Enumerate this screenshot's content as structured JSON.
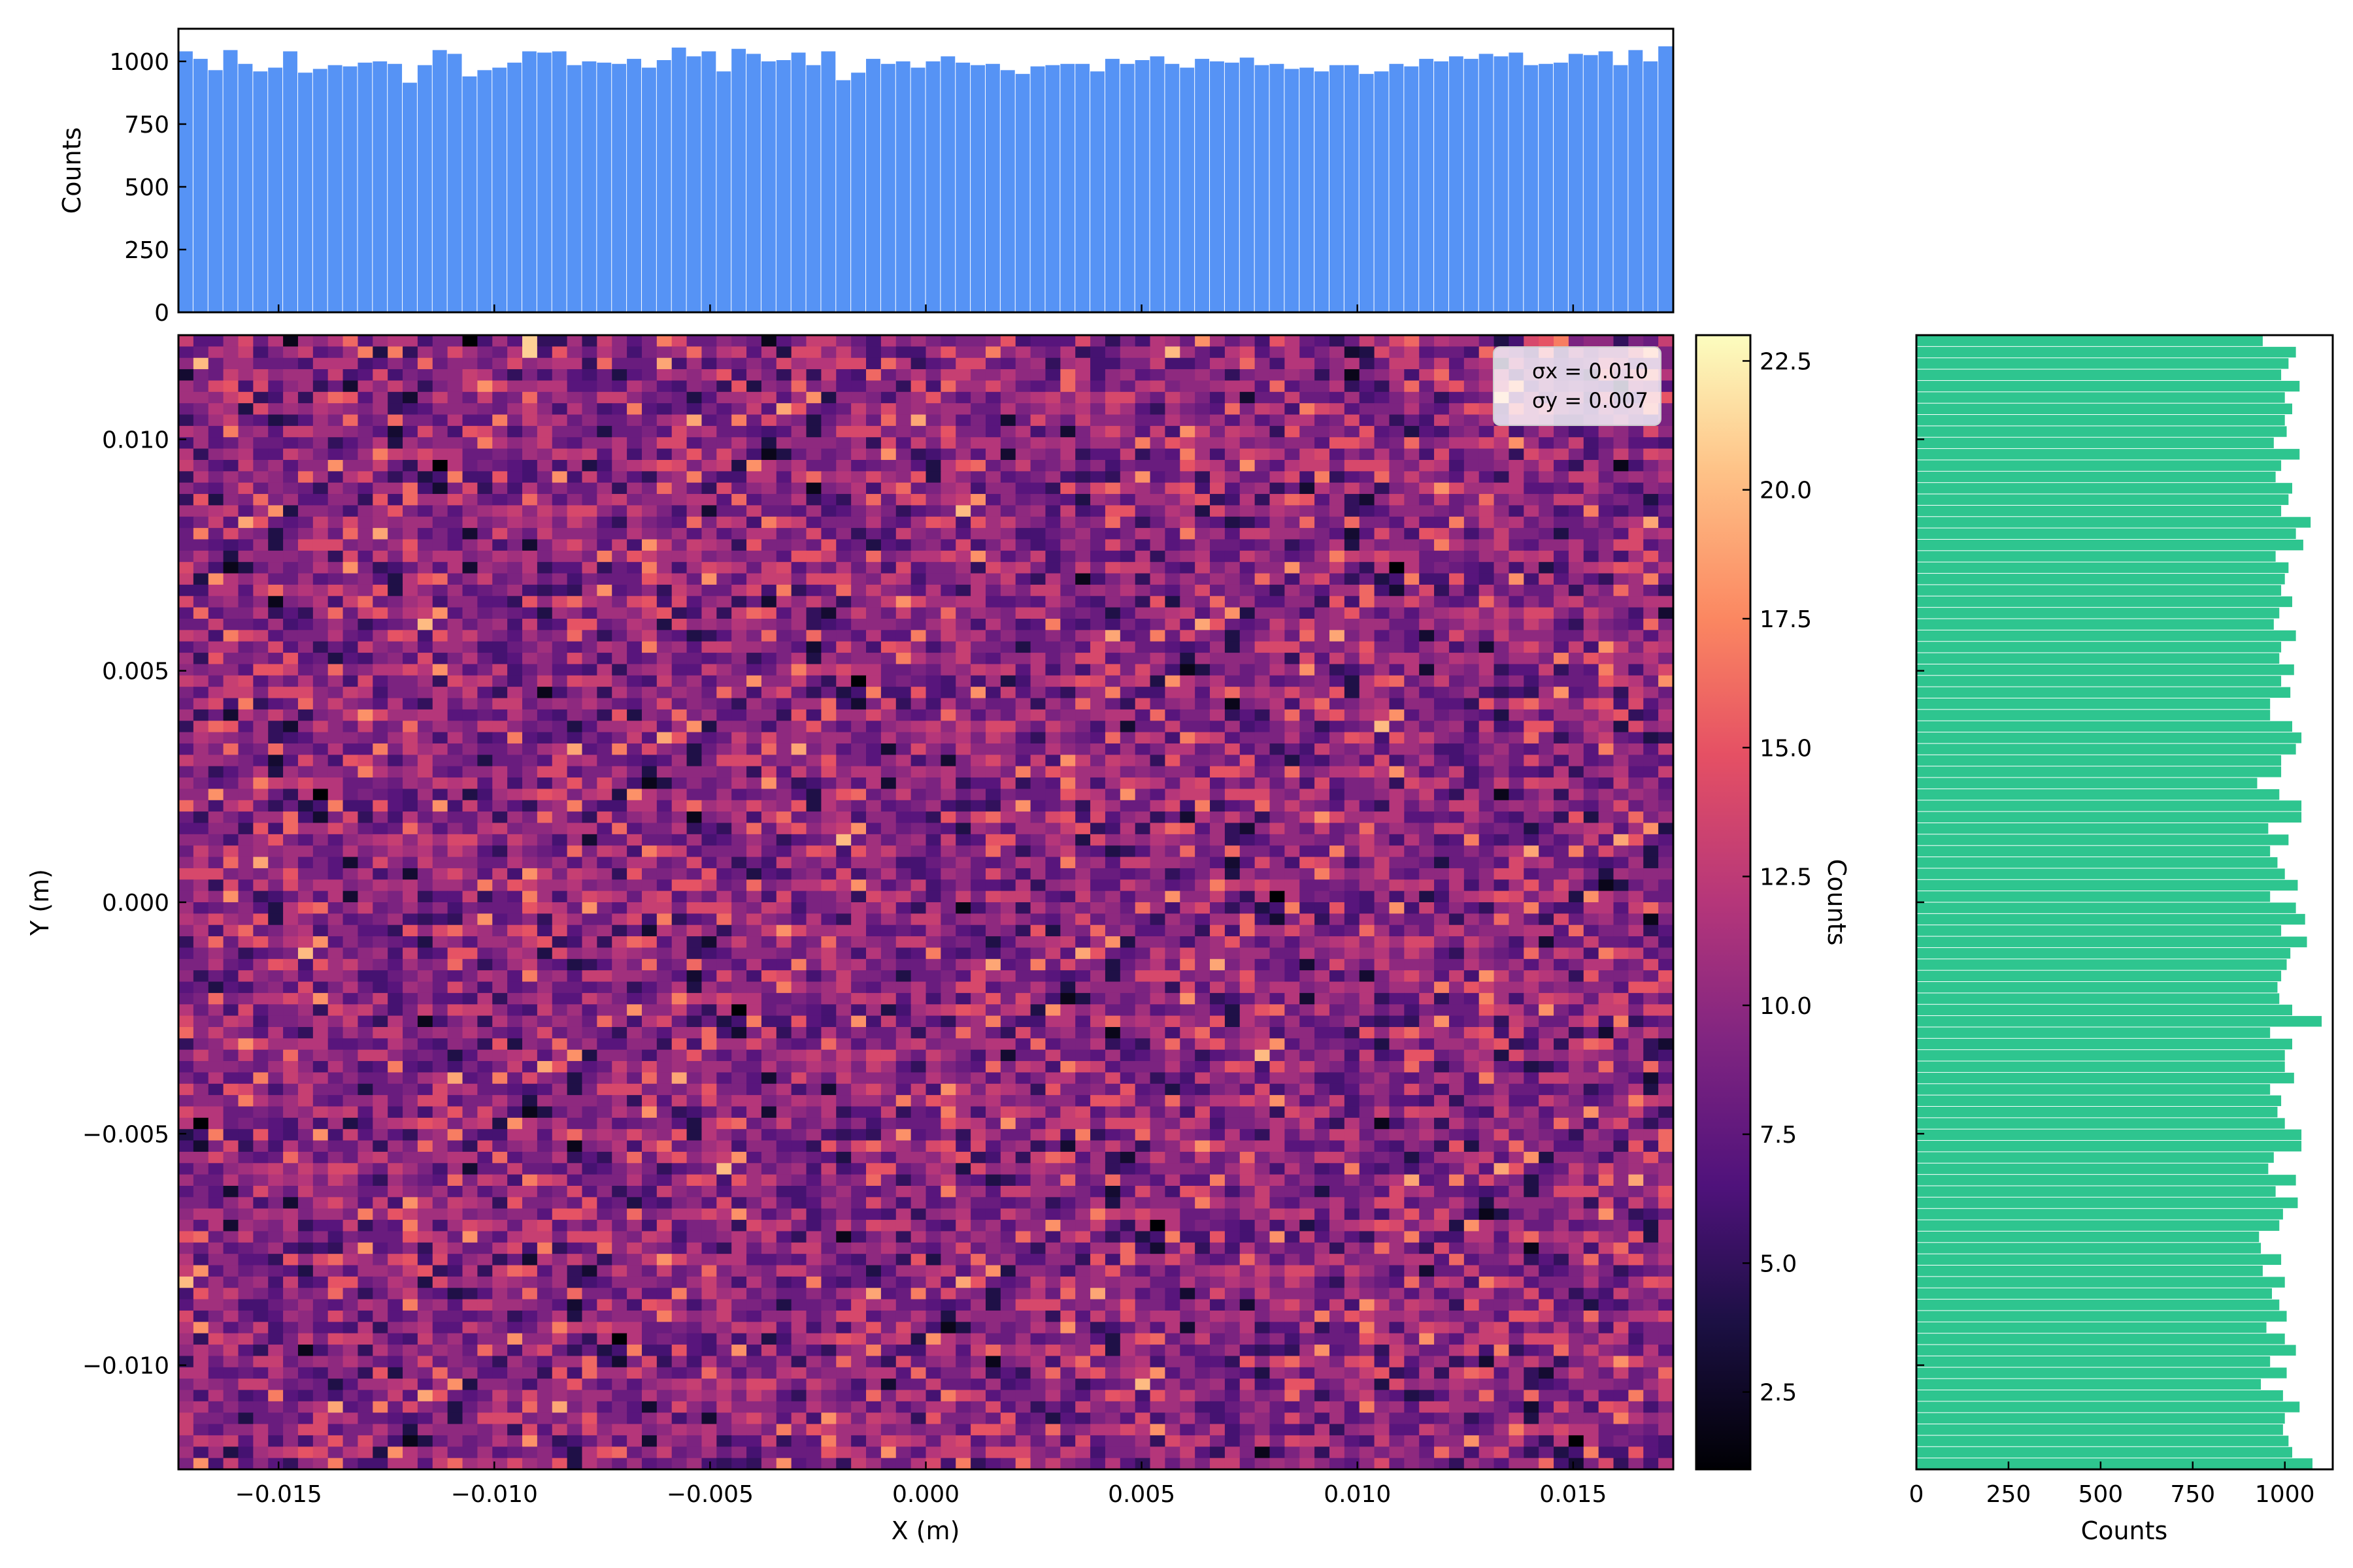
{
  "chart_data": [
    {
      "type": "heatmap",
      "xlabel": "X (m)",
      "ylabel": "Y (m)",
      "xlim": [
        -0.01732,
        0.01732
      ],
      "ylim": [
        -0.01225,
        0.01225
      ],
      "xticks": [
        -0.015,
        -0.01,
        -0.005,
        0.0,
        0.005,
        0.01,
        0.015
      ],
      "xtick_labels": [
        "−0.015",
        "−0.010",
        "−0.005",
        "0.000",
        "0.005",
        "0.010",
        "0.015"
      ],
      "yticks": [
        -0.01,
        -0.005,
        0.0,
        0.005,
        0.01
      ],
      "ytick_labels": [
        "−0.010",
        "−0.005",
        "0.000",
        "0.005",
        "0.010"
      ],
      "bins": [
        100,
        100
      ],
      "colormap": "magma",
      "color_range": [
        1,
        23
      ],
      "mean_count": 10,
      "annotation": {
        "sigma_x_label": "σx = 0.010",
        "sigma_y_label": "σy = 0.007"
      },
      "seed": 7
    },
    {
      "type": "bar",
      "orientation": "vertical",
      "ylabel": "Counts",
      "ylim": [
        0,
        1130
      ],
      "yticks": [
        0,
        250,
        500,
        750,
        1000
      ],
      "ytick_labels": [
        "0",
        "250",
        "500",
        "750",
        "1000"
      ],
      "bins": 100,
      "color": "#5693f5",
      "values": [
        1040,
        1010,
        965,
        1045,
        990,
        960,
        975,
        1040,
        955,
        970,
        985,
        980,
        995,
        1000,
        990,
        915,
        985,
        1045,
        1030,
        940,
        965,
        975,
        995,
        1040,
        1035,
        1040,
        985,
        1000,
        995,
        990,
        1010,
        975,
        1005,
        1055,
        1020,
        1040,
        960,
        1050,
        1030,
        1000,
        1005,
        1035,
        985,
        1040,
        925,
        955,
        1010,
        990,
        1000,
        975,
        1000,
        1020,
        995,
        985,
        990,
        965,
        950,
        980,
        985,
        990,
        990,
        960,
        1010,
        990,
        1005,
        1020,
        990,
        975,
        1010,
        1000,
        995,
        1015,
        985,
        990,
        970,
        975,
        960,
        985,
        985,
        950,
        960,
        990,
        980,
        1010,
        1000,
        1020,
        1010,
        1030,
        1020,
        1035,
        985,
        990,
        995,
        1030,
        1025,
        1040,
        985,
        1045,
        1000,
        1060
      ]
    },
    {
      "type": "bar",
      "orientation": "horizontal",
      "xlabel": "Counts",
      "xlim": [
        0,
        1130
      ],
      "xticks": [
        0,
        250,
        500,
        750,
        1000
      ],
      "xtick_labels": [
        "0",
        "250",
        "500",
        "750",
        "1000"
      ],
      "bins": 100,
      "color": "#2ec58f",
      "values": [
        1075,
        1020,
        1010,
        995,
        1000,
        1040,
        995,
        935,
        1005,
        960,
        1030,
        1000,
        950,
        1005,
        985,
        965,
        1000,
        940,
        990,
        935,
        930,
        985,
        995,
        1035,
        975,
        1030,
        955,
        970,
        1045,
        1045,
        1000,
        980,
        990,
        960,
        1025,
        1000,
        1000,
        1020,
        960,
        1100,
        1020,
        985,
        980,
        990,
        1005,
        1015,
        1060,
        990,
        1055,
        1030,
        960,
        1035,
        1000,
        980,
        960,
        1010,
        955,
        1045,
        1045,
        985,
        925,
        990,
        990,
        1030,
        1045,
        1020,
        960,
        960,
        1015,
        990,
        1025,
        985,
        990,
        1030,
        970,
        985,
        1020,
        990,
        1000,
        1010,
        975,
        1050,
        1030,
        1070,
        990,
        1010,
        1020,
        975,
        990,
        1040,
        970,
        1005,
        1000,
        1020,
        1000,
        1040,
        990,
        1010,
        1030,
        940
      ]
    }
  ]
}
